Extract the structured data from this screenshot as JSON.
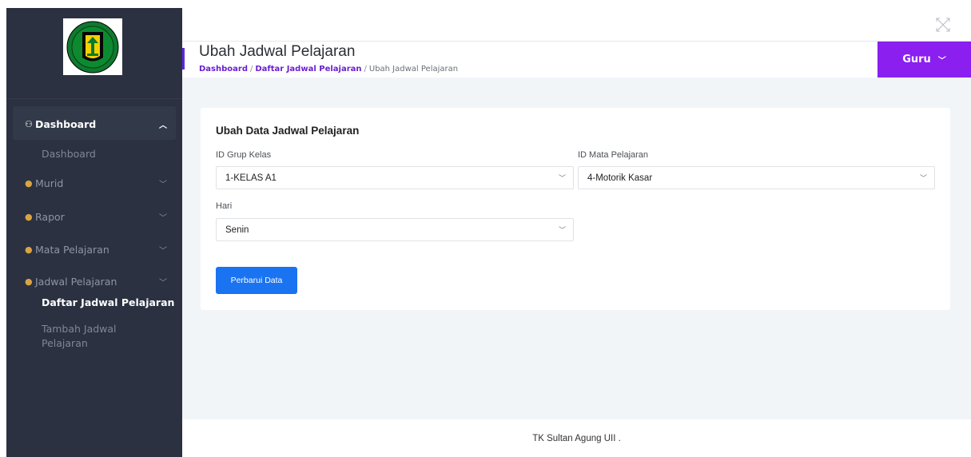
{
  "sidebar": {
    "sections": [
      {
        "label": "Dashboard",
        "icon": "dashboard-icon"
      },
      {
        "label": "Murid",
        "icon": "user-icon"
      },
      {
        "label": "Rapor",
        "icon": "user-icon"
      },
      {
        "label": "Mata Pelajaran",
        "icon": "user-icon"
      },
      {
        "label": "Jadwal Pelajaran",
        "icon": "user-icon"
      }
    ],
    "dashboard_sub": "Dashboard",
    "jadwal_sub": [
      "Daftar Jadwal Pelajaran",
      "Tambah Jadwal Pelajaran"
    ]
  },
  "header": {
    "title": "Ubah Jadwal Pelajaran",
    "breadcrumb": [
      "Dashboard",
      "Daftar Jadwal Pelajaran",
      "Ubah Jadwal Pelajaran"
    ],
    "user_menu": "Guru"
  },
  "form": {
    "title": "Ubah Data Jadwal Pelajaran",
    "grup_kelas_label": "ID Grup Kelas",
    "grup_kelas_value": "1-KELAS A1",
    "mapel_label": "ID Mata Pelajaran",
    "mapel_value": "4-Motorik Kasar",
    "hari_label": "Hari",
    "hari_value": "Senin",
    "submit_label": "Perbarui Data"
  },
  "footer": {
    "text": "TK Sultan Agung UII ."
  },
  "colors": {
    "sidebar": "#2b3140",
    "accent": "#8a1ff0",
    "button": "#1a73f0"
  }
}
